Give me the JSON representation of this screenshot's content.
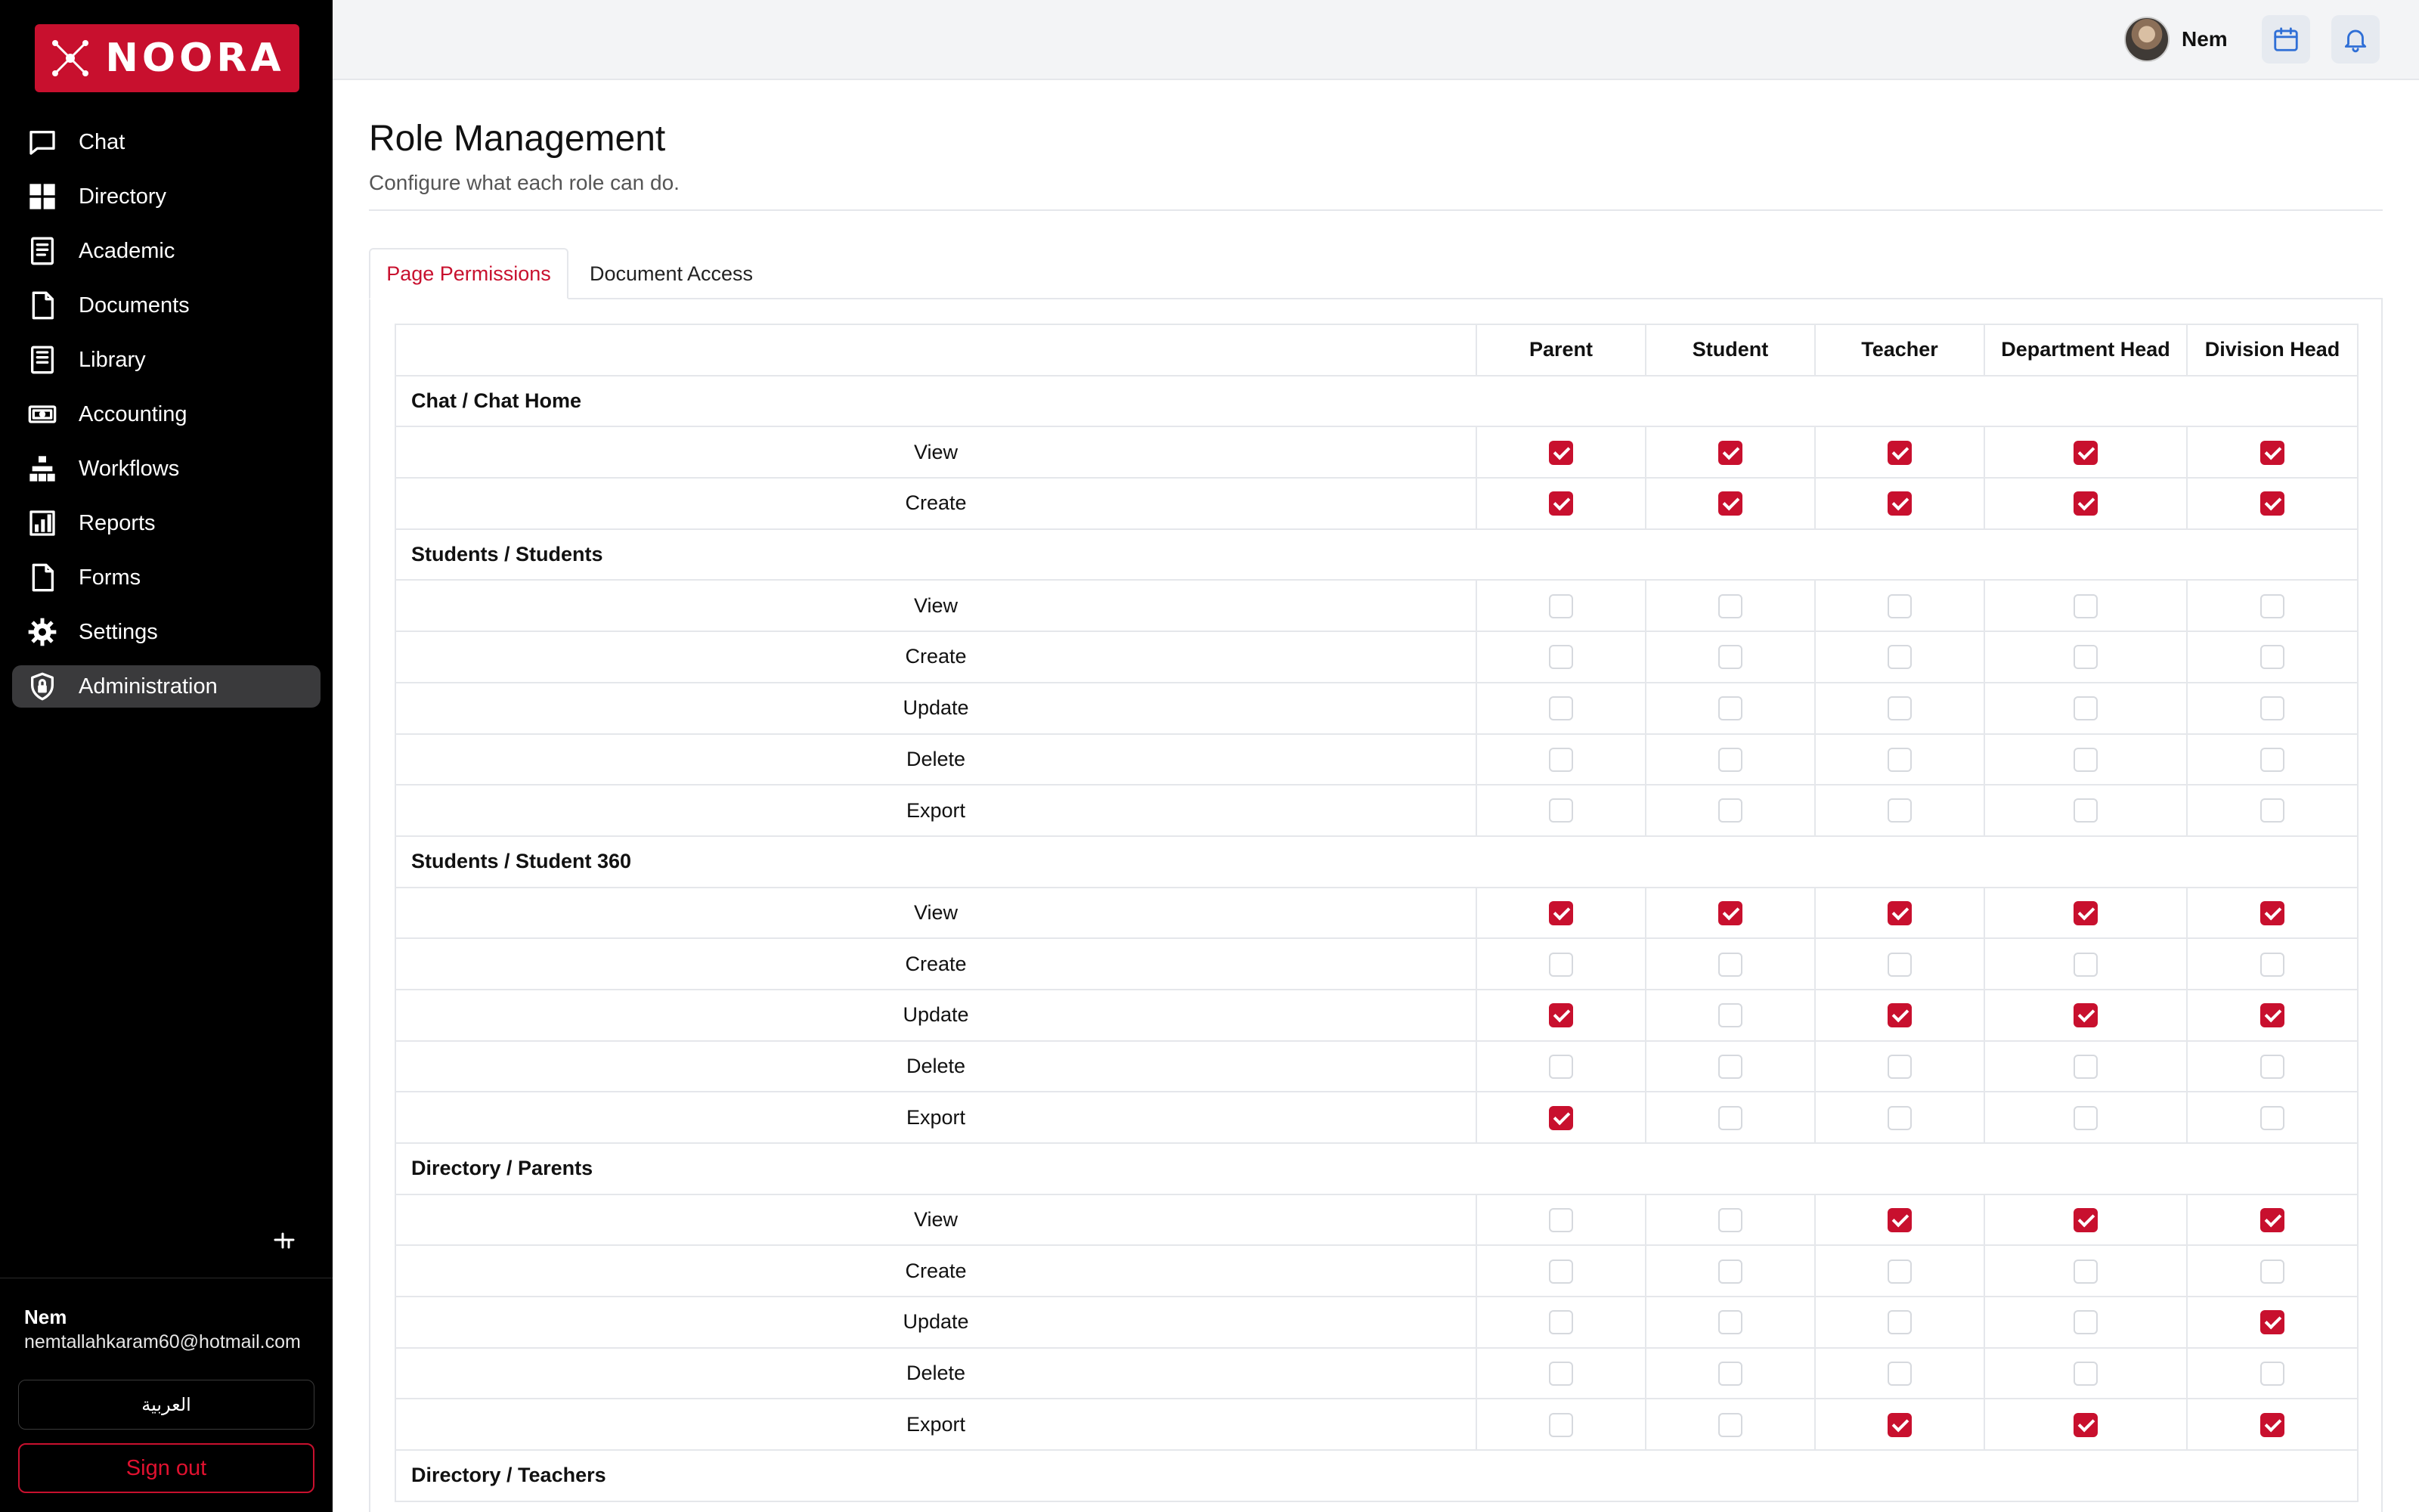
{
  "app": {
    "name": "NOORA"
  },
  "sidebar": {
    "items": [
      {
        "label": "Chat",
        "icon": "chat-icon",
        "active": false
      },
      {
        "label": "Directory",
        "icon": "grid-icon",
        "active": false
      },
      {
        "label": "Academic",
        "icon": "book-icon",
        "active": false
      },
      {
        "label": "Documents",
        "icon": "document-icon",
        "active": false
      },
      {
        "label": "Library",
        "icon": "library-icon",
        "active": false
      },
      {
        "label": "Accounting",
        "icon": "money-icon",
        "active": false
      },
      {
        "label": "Workflows",
        "icon": "workflow-icon",
        "active": false
      },
      {
        "label": "Reports",
        "icon": "reports-icon",
        "active": false
      },
      {
        "label": "Forms",
        "icon": "form-icon",
        "active": false
      },
      {
        "label": "Settings",
        "icon": "gear-icon",
        "active": false
      },
      {
        "label": "Administration",
        "icon": "shield-lock-icon",
        "active": true
      }
    ],
    "user": {
      "name": "Nem",
      "email": "nemtallahkaram60@hotmail.com"
    },
    "language_button": "العربية",
    "signout_button": "Sign out"
  },
  "topbar": {
    "username": "Nem",
    "icons": [
      "calendar-icon",
      "bell-icon"
    ]
  },
  "page": {
    "title": "Role Management",
    "subtitle": "Configure what each role can do."
  },
  "tabs": [
    {
      "label": "Page Permissions",
      "active": true
    },
    {
      "label": "Document Access",
      "active": false
    }
  ],
  "colors": {
    "brand": "#c8102e",
    "sidebar_bg": "#000000",
    "active_nav_bg": "#3a3a3c",
    "checkbox_on": "#c8102e",
    "border": "#e5e7eb"
  },
  "table": {
    "columns": [
      "Parent",
      "Student",
      "Teacher",
      "Department Head",
      "Division Head"
    ],
    "sections": [
      {
        "title": "Chat / Chat Home",
        "rows": [
          {
            "action": "View",
            "checks": [
              true,
              true,
              true,
              true,
              true
            ]
          },
          {
            "action": "Create",
            "checks": [
              true,
              true,
              true,
              true,
              true
            ]
          }
        ]
      },
      {
        "title": "Students / Students",
        "rows": [
          {
            "action": "View",
            "checks": [
              false,
              false,
              false,
              false,
              false
            ]
          },
          {
            "action": "Create",
            "checks": [
              false,
              false,
              false,
              false,
              false
            ]
          },
          {
            "action": "Update",
            "checks": [
              false,
              false,
              false,
              false,
              false
            ]
          },
          {
            "action": "Delete",
            "checks": [
              false,
              false,
              false,
              false,
              false
            ]
          },
          {
            "action": "Export",
            "checks": [
              false,
              false,
              false,
              false,
              false
            ]
          }
        ]
      },
      {
        "title": "Students / Student 360",
        "rows": [
          {
            "action": "View",
            "checks": [
              true,
              true,
              true,
              true,
              true
            ]
          },
          {
            "action": "Create",
            "checks": [
              false,
              false,
              false,
              false,
              false
            ]
          },
          {
            "action": "Update",
            "checks": [
              true,
              false,
              true,
              true,
              true
            ]
          },
          {
            "action": "Delete",
            "checks": [
              false,
              false,
              false,
              false,
              false
            ]
          },
          {
            "action": "Export",
            "checks": [
              true,
              false,
              false,
              false,
              false
            ]
          }
        ]
      },
      {
        "title": "Directory / Parents",
        "rows": [
          {
            "action": "View",
            "checks": [
              false,
              false,
              true,
              true,
              true
            ]
          },
          {
            "action": "Create",
            "checks": [
              false,
              false,
              false,
              false,
              false
            ]
          },
          {
            "action": "Update",
            "checks": [
              false,
              false,
              false,
              false,
              true
            ]
          },
          {
            "action": "Delete",
            "checks": [
              false,
              false,
              false,
              false,
              false
            ]
          },
          {
            "action": "Export",
            "checks": [
              false,
              false,
              true,
              true,
              true
            ]
          }
        ]
      },
      {
        "title": "Directory / Teachers",
        "rows": []
      }
    ]
  }
}
